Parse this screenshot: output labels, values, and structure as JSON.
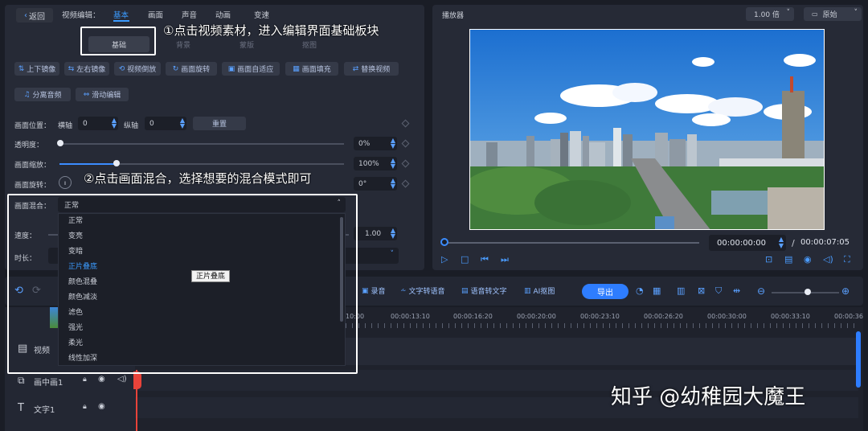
{
  "editor": {
    "back_label": "返回",
    "section_label": "视频编辑：",
    "tabs": [
      "基本",
      "画面",
      "声音",
      "动画",
      "变速"
    ],
    "subtabs": [
      "基础",
      "背景",
      "蒙版",
      "抠图"
    ],
    "buttons_row1": [
      "上下镜像",
      "左右镜像",
      "视频倒放",
      "画面旋转",
      "画面自适应",
      "画面填充",
      "替换视频"
    ],
    "buttons_row2": [
      "分离音频",
      "滑动编辑"
    ],
    "position_label": "画面位置：",
    "x_label": "横轴",
    "x_value": "0",
    "y_label": "纵轴",
    "y_value": "0",
    "reset_label": "重置",
    "opacity_label": "透明度：",
    "opacity_value": "0%",
    "opacity_level": 0,
    "scale_label": "画面缩放：",
    "scale_value": "100%",
    "scale_level": 0.2,
    "rotate_label": "画面旋转：",
    "rotate_value": "0°",
    "blend_label": "画面混合：",
    "blend_value": "正常",
    "speed_label": "速度：",
    "speed_value": "1.00",
    "duration_label": "时长："
  },
  "blend_dropdown": {
    "options": [
      "正常",
      "变亮",
      "变暗",
      "正片叠底",
      "颜色混叠",
      "颜色减淡",
      "滤色",
      "强光",
      "柔光",
      "线性加深"
    ],
    "selected_index": 3,
    "tooltip": "正片叠底"
  },
  "player": {
    "title": "播放器",
    "speed_select": "1.00 倍",
    "ratio_select": "原始",
    "current_time": "00:00:00:00",
    "separator": "/",
    "total_time": "00:00:07:05"
  },
  "toolbar": {
    "items": [
      "录音",
      "文字转语音",
      "语音转文字",
      "AI抠图"
    ],
    "export_label": "导出"
  },
  "timeline": {
    "ticks": [
      "00:00:13:10",
      "00:00:16:20",
      "00:00:20:00",
      "00:00:23:10",
      "00:00:26:20",
      "00:00:30:00",
      "00:00:33:10",
      "00:00:36"
    ],
    "partial_tick": "10:00",
    "tracks": [
      {
        "icon": "film-icon",
        "name": "视频"
      },
      {
        "icon": "pip-icon",
        "name": "画中画1"
      },
      {
        "icon": "text-icon",
        "name": "文字1"
      }
    ]
  },
  "annotations": {
    "step1": "①点击视频素材，进入编辑界面基础板块",
    "step2": "②点击画面混合，选择想要的混合模式即可"
  },
  "watermark": "知乎 @幼稚园大魔王",
  "colors": {
    "accent": "#3b8cff",
    "panel": "#262a36",
    "background": "#1a1d26",
    "export_button": "#2e7dff"
  }
}
